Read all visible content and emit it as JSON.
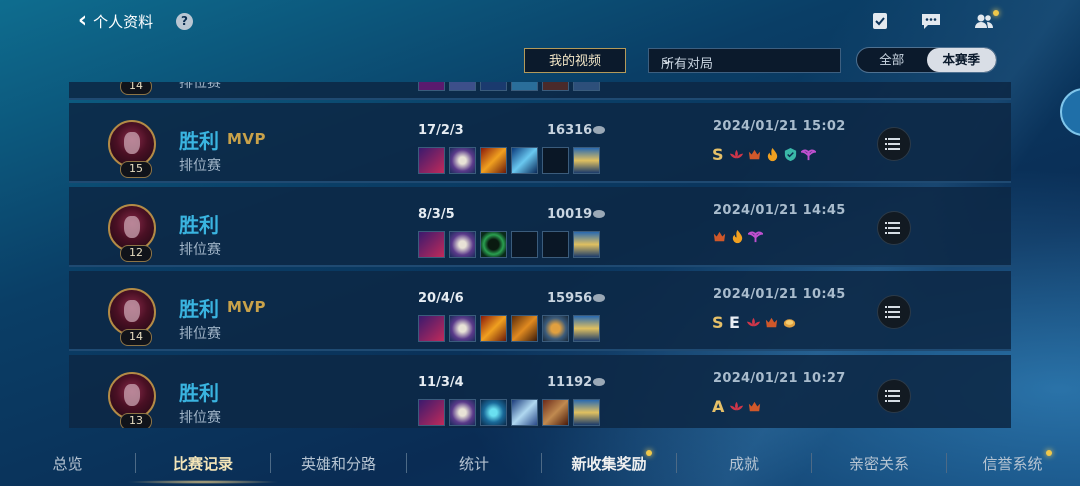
{
  "header": {
    "back_label": "个人资料",
    "help_label": "?"
  },
  "header_icons": [
    "clipboard-check-icon",
    "chat-bubble-icon",
    "friends-icon"
  ],
  "filters": {
    "my_video": "我的视频",
    "match_type": "所有对局",
    "seg_all": "全部",
    "seg_season": "本赛季"
  },
  "top_partial": {
    "level": "14",
    "mode": "排位赛"
  },
  "matches": [
    {
      "result": "胜利",
      "mvp": "MVP",
      "mode": "排位赛",
      "level": "15",
      "kda": "17/2/3",
      "gold": "16316",
      "time": "2024/01/21 15:02",
      "badges": [
        "S",
        "lotus",
        "crown-red",
        "flame",
        "shield",
        "wings"
      ]
    },
    {
      "result": "胜利",
      "mvp": "",
      "mode": "排位赛",
      "level": "12",
      "kda": "8/3/5",
      "gold": "10019",
      "time": "2024/01/21 14:45",
      "badges": [
        "crown-red",
        "flame",
        "wings"
      ]
    },
    {
      "result": "胜利",
      "mvp": "MVP",
      "mode": "排位赛",
      "level": "14",
      "kda": "20/4/6",
      "gold": "15956",
      "time": "2024/01/21 10:45",
      "badges": [
        "S",
        "E",
        "lotus",
        "crown-red",
        "coin"
      ]
    },
    {
      "result": "胜利",
      "mvp": "",
      "mode": "排位赛",
      "level": "13",
      "kda": "11/3/4",
      "gold": "11192",
      "time": "2024/01/21 10:27",
      "badges": [
        "A",
        "lotus",
        "crown-red"
      ]
    }
  ],
  "nav": [
    "总览",
    "比赛记录",
    "英雄和分路",
    "统计",
    "新收集奖励",
    "成就",
    "亲密关系",
    "信誉系统"
  ],
  "nav_active": "比赛记录"
}
